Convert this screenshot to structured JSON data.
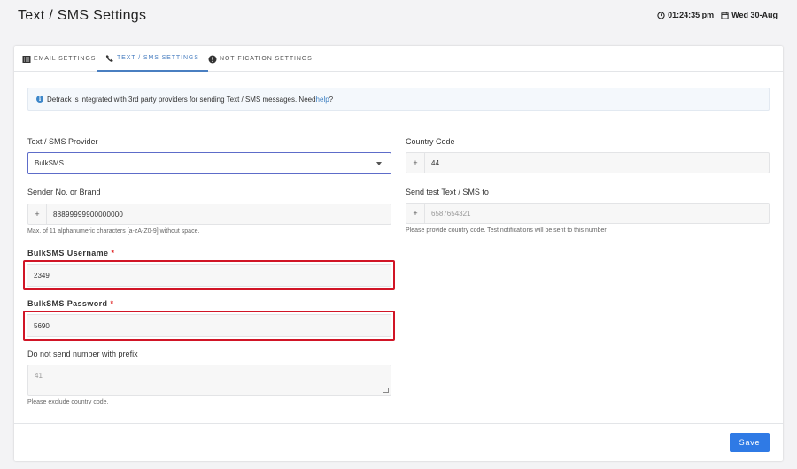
{
  "header": {
    "title": "Text / SMS Settings",
    "time": "01:24:35 pm",
    "date": "Wed 30-Aug"
  },
  "tabs": [
    {
      "label": "EMAIL SETTINGS",
      "icon": "list-icon"
    },
    {
      "label": "TEXT / SMS SETTINGS",
      "icon": "phone-icon",
      "active": true
    },
    {
      "label": "NOTIFICATION SETTINGS",
      "icon": "alert-icon"
    }
  ],
  "alert": {
    "text": "Detrack is integrated with 3rd party providers for sending Text / SMS messages. Need ",
    "link": "help",
    "suffix": "?"
  },
  "form": {
    "provider": {
      "label": "Text / SMS Provider",
      "value": "BulkSMS"
    },
    "country_code": {
      "label": "Country Code",
      "prefix": "+",
      "value": "44"
    },
    "sender": {
      "label": "Sender No. or Brand",
      "prefix": "+",
      "value": "88899999900000000",
      "hint": "Max. of 11 alphanumeric characters [a-zA-Z0-9] without space."
    },
    "test_to": {
      "label": "Send test Text / SMS to",
      "prefix": "+",
      "placeholder": "6587654321",
      "hint": "Please provide country code. Test notifications will be sent to this number."
    },
    "username": {
      "label": "BulkSMS Username",
      "required": "*",
      "value": "2349"
    },
    "password": {
      "label": "BulkSMS Password",
      "required": "*",
      "value": "5690"
    },
    "no_prefix": {
      "label": "Do not send number with prefix",
      "placeholder": "41",
      "hint": "Please exclude country code."
    }
  },
  "footer": {
    "save_label": "Save"
  },
  "colors": {
    "accent": "#2f7ae5",
    "tab_active": "#4a7fc1",
    "highlight": "#d11526",
    "select_border": "#5d6cc9"
  }
}
